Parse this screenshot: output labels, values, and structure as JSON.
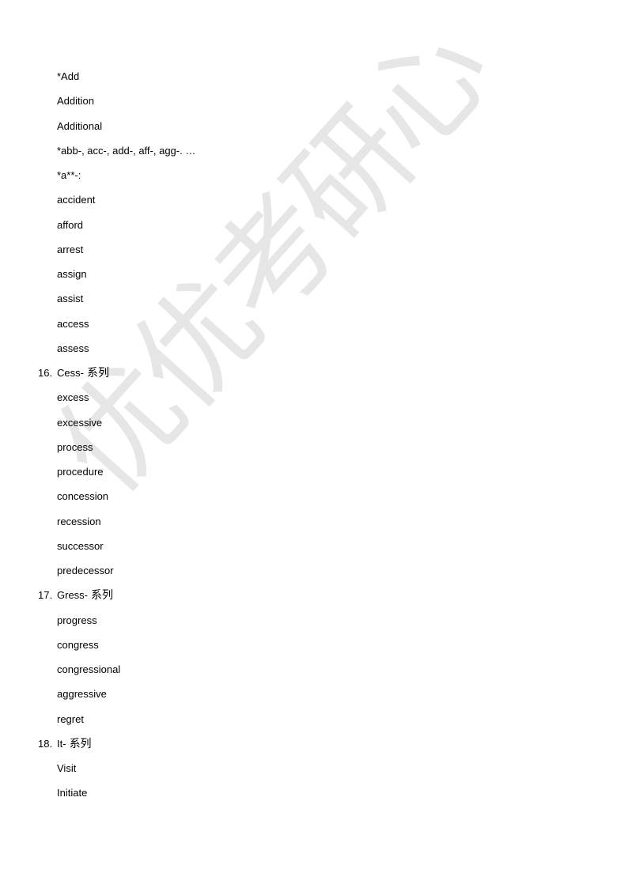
{
  "watermark": "优优考研心",
  "lines": [
    {
      "type": "item",
      "text": "*Add"
    },
    {
      "type": "item",
      "text": "Addition"
    },
    {
      "type": "item",
      "text": "Additional"
    },
    {
      "type": "item",
      "text": "*abb-, acc-, add-, aff-, agg-. …"
    },
    {
      "type": "item",
      "text": "*a**-:"
    },
    {
      "type": "item",
      "text": "accident"
    },
    {
      "type": "item",
      "text": "afford"
    },
    {
      "type": "item",
      "text": "arrest"
    },
    {
      "type": "item",
      "text": "assign"
    },
    {
      "type": "item",
      "text": "assist"
    },
    {
      "type": "item",
      "text": "access"
    },
    {
      "type": "item",
      "text": "assess"
    },
    {
      "type": "heading",
      "num": "16.",
      "text": "Cess-",
      "suffix": "系列"
    },
    {
      "type": "item",
      "text": "excess"
    },
    {
      "type": "item",
      "text": "excessive"
    },
    {
      "type": "item",
      "text": "process"
    },
    {
      "type": "item",
      "text": "procedure"
    },
    {
      "type": "item",
      "text": "concession"
    },
    {
      "type": "item",
      "text": "recession"
    },
    {
      "type": "item",
      "text": "successor"
    },
    {
      "type": "item",
      "text": "predecessor"
    },
    {
      "type": "heading",
      "num": "17.",
      "text": "Gress-",
      "suffix": "系列"
    },
    {
      "type": "item",
      "text": "progress"
    },
    {
      "type": "item",
      "text": "congress"
    },
    {
      "type": "item",
      "text": "congressional"
    },
    {
      "type": "item",
      "text": "aggressive"
    },
    {
      "type": "item",
      "text": "regret"
    },
    {
      "type": "heading",
      "num": "18.",
      "text": "It-",
      "suffix": "系列"
    },
    {
      "type": "item",
      "text": "Visit"
    },
    {
      "type": "item",
      "text": "Initiate"
    }
  ]
}
